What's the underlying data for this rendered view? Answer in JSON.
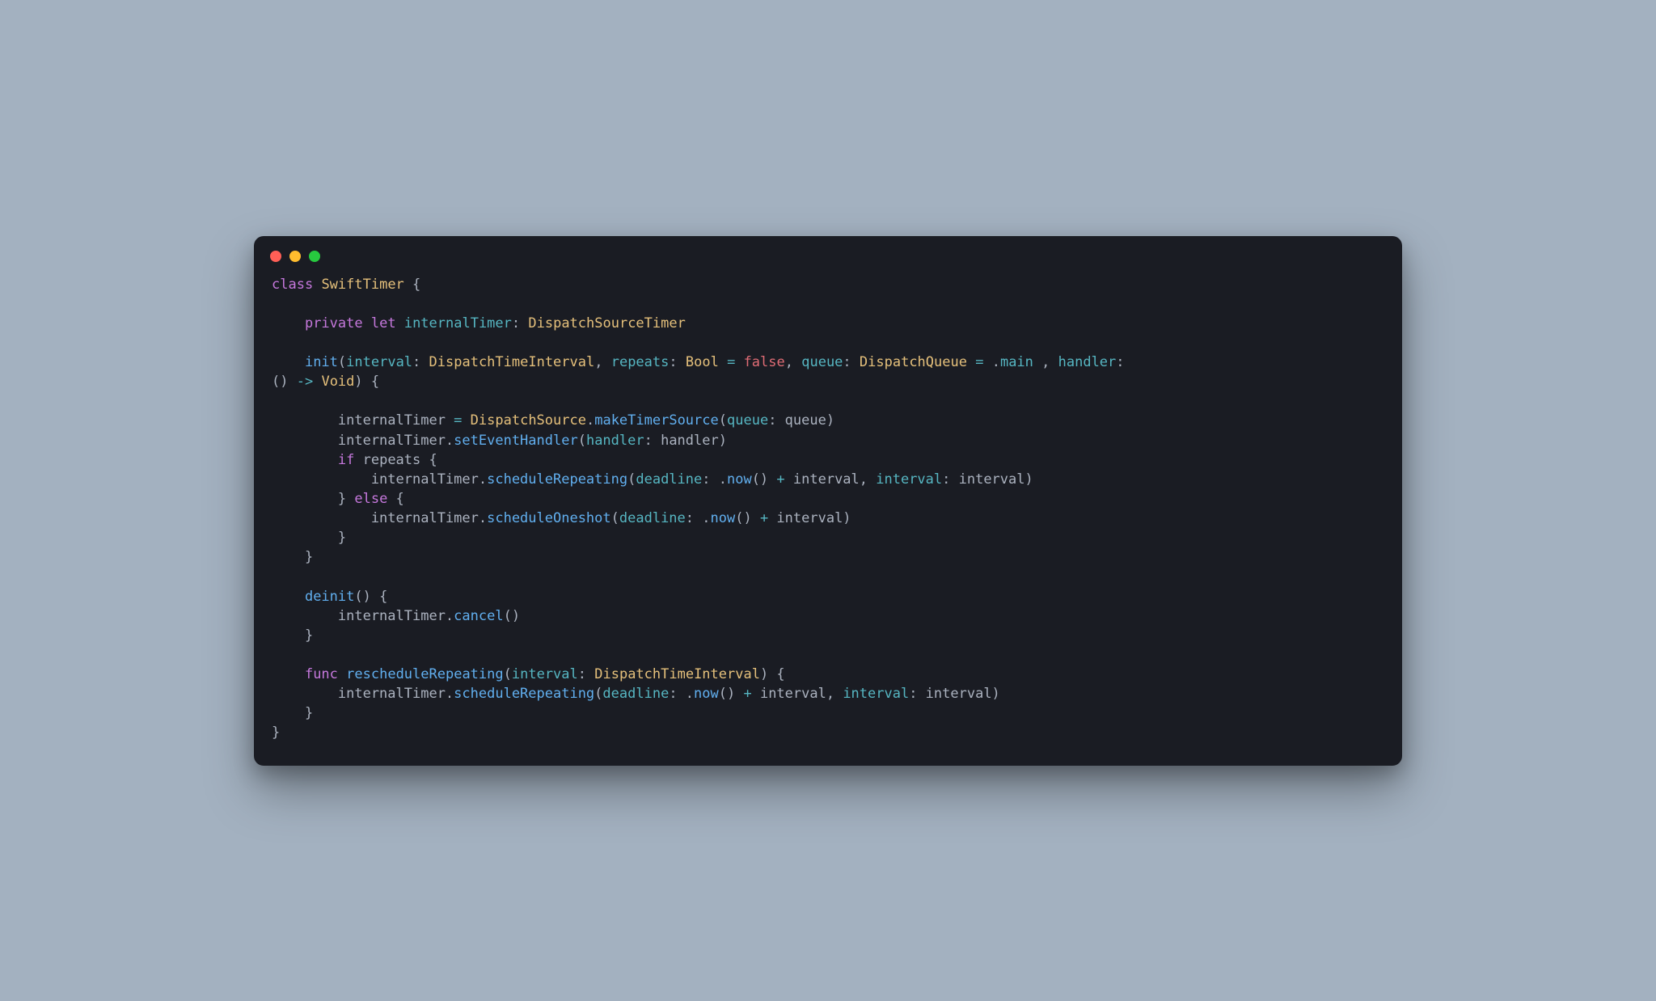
{
  "window": {
    "traffic_lights": [
      "close",
      "minimize",
      "zoom"
    ]
  },
  "code": {
    "tokens": [
      [
        [
          "kw",
          "class"
        ],
        [
          "punc",
          " "
        ],
        [
          "type",
          "SwiftTimer"
        ],
        [
          "punc",
          " {"
        ]
      ],
      [],
      [
        [
          "punc",
          "    "
        ],
        [
          "kw",
          "private"
        ],
        [
          "punc",
          " "
        ],
        [
          "kw",
          "let"
        ],
        [
          "punc",
          " "
        ],
        [
          "id",
          "internalTimer"
        ],
        [
          "punc",
          ": "
        ],
        [
          "type",
          "DispatchSourceTimer"
        ]
      ],
      [
        [
          "punc",
          "    "
        ]
      ],
      [
        [
          "punc",
          "    "
        ],
        [
          "fn",
          "init"
        ],
        [
          "punc",
          "("
        ],
        [
          "id",
          "interval"
        ],
        [
          "punc",
          ": "
        ],
        [
          "type",
          "DispatchTimeInterval"
        ],
        [
          "punc",
          ", "
        ],
        [
          "id",
          "repeats"
        ],
        [
          "punc",
          ": "
        ],
        [
          "type",
          "Bool"
        ],
        [
          "punc",
          " "
        ],
        [
          "op",
          "="
        ],
        [
          "punc",
          " "
        ],
        [
          "prop",
          "false"
        ],
        [
          "punc",
          ", "
        ],
        [
          "id",
          "queue"
        ],
        [
          "punc",
          ": "
        ],
        [
          "type",
          "DispatchQueue"
        ],
        [
          "punc",
          " "
        ],
        [
          "op",
          "="
        ],
        [
          "punc",
          " ."
        ],
        [
          "id",
          "main"
        ],
        [
          "punc",
          " , "
        ],
        [
          "id",
          "handler"
        ],
        [
          "punc",
          ": "
        ]
      ],
      [
        [
          "punc",
          "() "
        ],
        [
          "op",
          "->"
        ],
        [
          "punc",
          " "
        ],
        [
          "type",
          "Void"
        ],
        [
          "punc",
          ") {"
        ]
      ],
      [
        [
          "punc",
          "        "
        ]
      ],
      [
        [
          "punc",
          "        internalTimer "
        ],
        [
          "op",
          "="
        ],
        [
          "punc",
          " "
        ],
        [
          "type",
          "DispatchSource"
        ],
        [
          "punc",
          "."
        ],
        [
          "fn",
          "makeTimerSource"
        ],
        [
          "punc",
          "("
        ],
        [
          "id",
          "queue"
        ],
        [
          "punc",
          ": queue)"
        ]
      ],
      [
        [
          "punc",
          "        internalTimer."
        ],
        [
          "fn",
          "setEventHandler"
        ],
        [
          "punc",
          "("
        ],
        [
          "id",
          "handler"
        ],
        [
          "punc",
          ": handler)"
        ]
      ],
      [
        [
          "punc",
          "        "
        ],
        [
          "kw",
          "if"
        ],
        [
          "punc",
          " repeats {"
        ]
      ],
      [
        [
          "punc",
          "            internalTimer."
        ],
        [
          "fn",
          "scheduleRepeating"
        ],
        [
          "punc",
          "("
        ],
        [
          "id",
          "deadline"
        ],
        [
          "punc",
          ": ."
        ],
        [
          "fn",
          "now"
        ],
        [
          "punc",
          "() "
        ],
        [
          "op",
          "+"
        ],
        [
          "punc",
          " interval, "
        ],
        [
          "id",
          "interval"
        ],
        [
          "punc",
          ": interval)"
        ]
      ],
      [
        [
          "punc",
          "        } "
        ],
        [
          "kw",
          "else"
        ],
        [
          "punc",
          " {"
        ]
      ],
      [
        [
          "punc",
          "            internalTimer."
        ],
        [
          "fn",
          "scheduleOneshot"
        ],
        [
          "punc",
          "("
        ],
        [
          "id",
          "deadline"
        ],
        [
          "punc",
          ": ."
        ],
        [
          "fn",
          "now"
        ],
        [
          "punc",
          "() "
        ],
        [
          "op",
          "+"
        ],
        [
          "punc",
          " interval)"
        ]
      ],
      [
        [
          "punc",
          "        }"
        ]
      ],
      [
        [
          "punc",
          "    }"
        ]
      ],
      [
        [
          "punc",
          "    "
        ]
      ],
      [
        [
          "punc",
          "    "
        ],
        [
          "fn",
          "deinit"
        ],
        [
          "punc",
          "() {"
        ]
      ],
      [
        [
          "punc",
          "        internalTimer."
        ],
        [
          "fn",
          "cancel"
        ],
        [
          "punc",
          "()"
        ]
      ],
      [
        [
          "punc",
          "    }"
        ]
      ],
      [
        [
          "punc",
          "    "
        ]
      ],
      [
        [
          "punc",
          "    "
        ],
        [
          "kw",
          "func"
        ],
        [
          "punc",
          " "
        ],
        [
          "fn",
          "rescheduleRepeating"
        ],
        [
          "punc",
          "("
        ],
        [
          "id",
          "interval"
        ],
        [
          "punc",
          ": "
        ],
        [
          "type",
          "DispatchTimeInterval"
        ],
        [
          "punc",
          ") {"
        ]
      ],
      [
        [
          "punc",
          "        internalTimer."
        ],
        [
          "fn",
          "scheduleRepeating"
        ],
        [
          "punc",
          "("
        ],
        [
          "id",
          "deadline"
        ],
        [
          "punc",
          ": ."
        ],
        [
          "fn",
          "now"
        ],
        [
          "punc",
          "() "
        ],
        [
          "op",
          "+"
        ],
        [
          "punc",
          " interval, "
        ],
        [
          "id",
          "interval"
        ],
        [
          "punc",
          ": interval)"
        ]
      ],
      [
        [
          "punc",
          "    }"
        ]
      ],
      [
        [
          "punc",
          "}"
        ]
      ]
    ]
  }
}
